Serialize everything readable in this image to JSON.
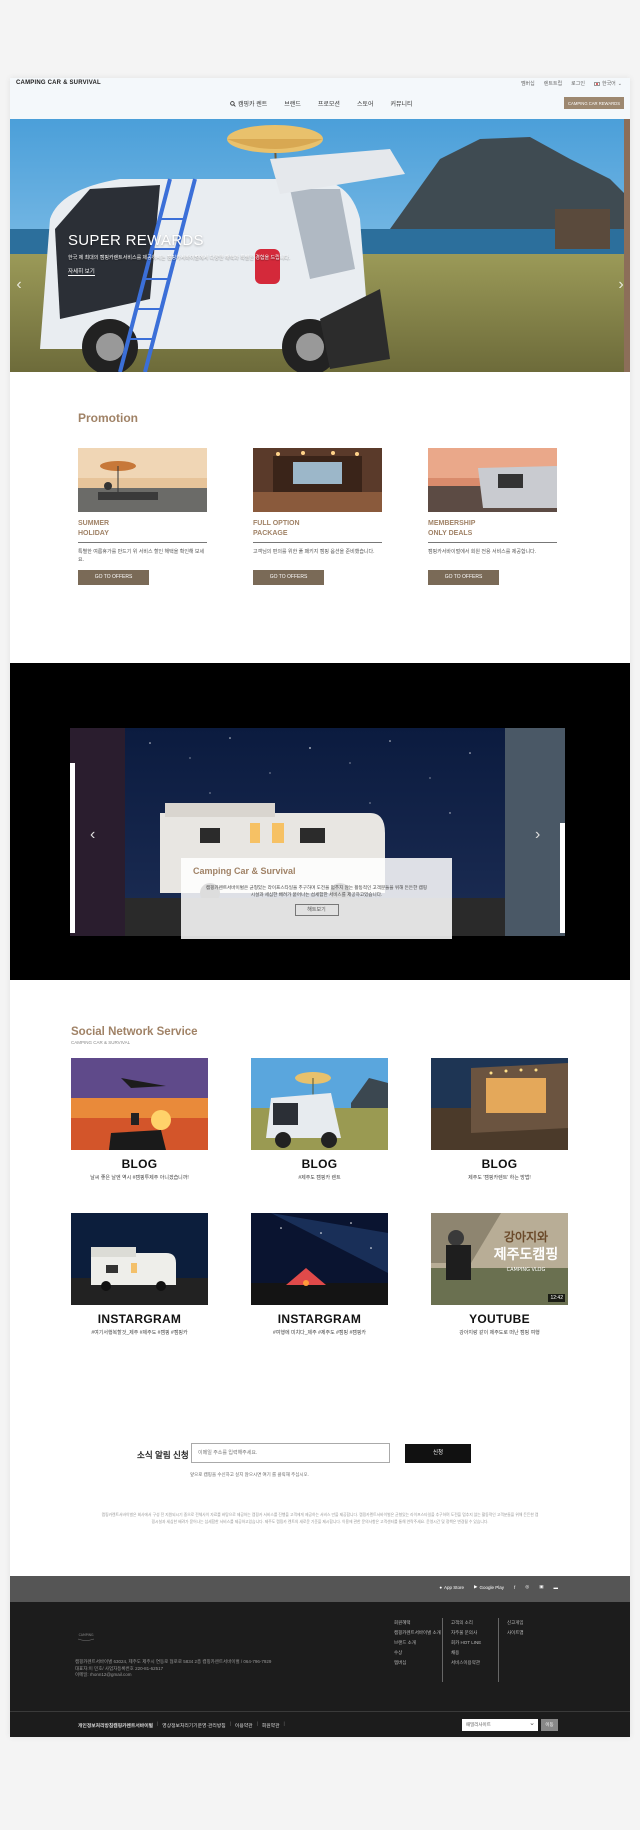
{
  "header": {
    "logo": "CAMPING CAR & SURVIVAL",
    "util_links": [
      "멤버십",
      "렌트트립",
      "로그인"
    ],
    "language": "한국어",
    "nav": [
      "캠핑카 렌트",
      "브랜드",
      "프로모션",
      "스토어",
      "커뮤니티"
    ],
    "cta": "CAMPING CAR REWARDS"
  },
  "hero": {
    "title": "SUPER REWARDS",
    "description": "한국 제 최대의 캠핑카렌트서비스를 제공하시는 캠핑카서바이벌에서 다양한 해택과 특별한 경험을 드립니다.",
    "link": "자세히 보기",
    "prev_arrow": "‹",
    "next_arrow": "›"
  },
  "promotion": {
    "title": "Promotion",
    "cards": [
      {
        "name_line1": "SUMMER",
        "name_line2": "HOLIDAY",
        "text": "특별한 여름휴가를 만드기 위 서비스 할인 해택을 확인해 보세요.",
        "button": "GO TO OFFERS"
      },
      {
        "name_line1": "FULL OPTION",
        "name_line2": "PACKAGE",
        "text": "고객님의 편의를 위한 풀 패키지 캠핑 옵션을 준비했습니다.",
        "button": "GO TO OFFERS"
      },
      {
        "name_line1": "MEMBERSHIP",
        "name_line2": "ONLY DEALS",
        "text": "캠핑카서바이벌에서 회원 전용 서비스를 제공합니다.",
        "button": "GO TO OFFERS"
      }
    ]
  },
  "feature": {
    "title": "Camping Car & Survival",
    "description_line1": "캠핑카렌트서바이벌은 균형있는 라이프스타일을 추구하며 도전을 멈추지 않는 활동적인 고객분들을 위해 든든한 캠핑",
    "description_line2": "시설과 세심한 배려가 묻어나는 섬세함한 서비스를 제공하고있습니다.",
    "button": "해트보기",
    "prev_arrow": "‹",
    "next_arrow": "›"
  },
  "social": {
    "title": "Social Network Service",
    "subtitle": "CAMPING CAR & SURVIVAL",
    "cards": [
      {
        "name": "BLOG",
        "desc": "날씨 좋은 날엔 역시 #캠핑투제주 아니겠습니까!"
      },
      {
        "name": "BLOG",
        "desc": "#제주도 캠핑카 렌트"
      },
      {
        "name": "BLOG",
        "desc": "제주도 '캠핑카렌트' 하는 방법!"
      },
      {
        "name": "INSTARGRAM",
        "desc": "#여기서행복할것_제주 #제주도 #캠핑 #캠핑카"
      },
      {
        "name": "INSTARGRAM",
        "desc": "#여행에 미치다_제주 #제주도 #캠핑 #캠핑카"
      },
      {
        "name": "YOUTUBE",
        "desc": "강아지랑 같이 제주도로 떠난 캠핑 여행"
      }
    ],
    "video_badge": "12:42",
    "video_overlay_line1": "강아지와",
    "video_overlay_line2": "제주도캠핑",
    "video_overlay_line3": "CAMPING VLOG"
  },
  "newsletter": {
    "label": "소식 알림 신청",
    "placeholder": "이메일 주소를 입력해주세요.",
    "button": "신청",
    "note": "앞으로 캠핑을 수신하고 싶지 않으시면 여기 를 클릭해 주십시오."
  },
  "legal_text": "캠핑카렌트서바이벌은 회사에서 구성 전 지원되시기 중으로 전체사이 자료를 바탕으로 제공하는 캠핑카 서비스를 진행을 고객에게 제공하는 서비스 만을 제공합니다. 캠핑카렌트서바이벌은 균형있는 라이프스타일을 추구하며 도전을 멈추지 않는 활동적인 고객분들을 위해 든든한 캠핑시설과 세심한 배려가 묻어나는 섬세함한 서비스를 제공하고있습니다. 제주도 캠핑카 렌트의 새로운 기준을 제시합니다. 이용에 관한 문의사항은 고객센터를 통해 연락주세요. 운영시간 및 정책은 변경될 수 있습니다.",
  "footer": {
    "app_store": "App Store",
    "google_play": "Google Play",
    "logo_text": "CAMPING",
    "info_line1": "캠핑카렌트서바이벌 63024, 제주도 제주시 연동로 협로로 5834 2층 캠핑카렌트서바이벌 / 064-796-7929",
    "info_line2": "대표자:이 민호/ 사업자등록번호 220-81-62517",
    "info_line3": "이메일: rhonn12@gmail.com",
    "col1": [
      "회원혜택",
      "캠핑카렌트서바이벌 소개",
      "브랜드 소개",
      "수상",
      "멤버십"
    ],
    "col2": [
      "고객의 소리",
      "자주물 문의사",
      "회카 HOT LINE",
      "채용",
      "서비스이용약관"
    ],
    "col3": [
      "신고게임",
      "사이트맵"
    ],
    "policies": [
      "개인정보처리방침캠핑카렌트서바이벌",
      "영상정보처리기기운영·관리방침",
      "이용약관",
      "회원약관"
    ],
    "family_site": "패밀리사이트",
    "family_btn": "이동"
  },
  "colors": {
    "accent": "#a08266",
    "button": "#7a6a57",
    "footer": "#1c1c1c",
    "app_bar": "#555555"
  }
}
